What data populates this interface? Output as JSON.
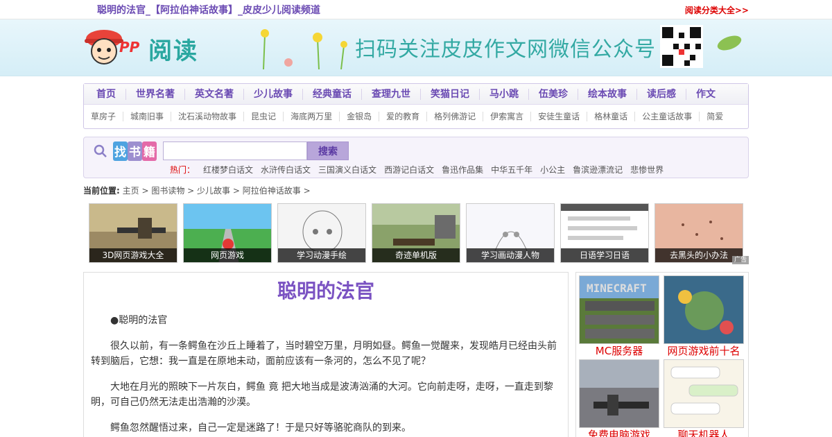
{
  "topbar": {
    "title": "聪明的法官_【阿拉伯神话故事】_皮皮少儿阅读频道",
    "right_link": "阅读分类大全>>"
  },
  "header": {
    "logo_pp": "PP",
    "logo_text": "阅读",
    "slogan": "扫码关注皮皮作文网微信公众号"
  },
  "nav_main": [
    "首页",
    "世界名著",
    "英文名著",
    "少儿故事",
    "经典童话",
    "查理九世",
    "笑猫日记",
    "马小跳",
    "伍美珍",
    "绘本故事",
    "读后感",
    "作文"
  ],
  "nav_sub": [
    "草房子",
    "城南旧事",
    "沈石溪动物故事",
    "昆虫记",
    "海底两万里",
    "金银岛",
    "爱的教育",
    "格列佛游记",
    "伊索寓言",
    "安徒生童话",
    "格林童话",
    "公主童话故事",
    "简爱"
  ],
  "search": {
    "badge": [
      "找",
      "书",
      "籍"
    ],
    "input_value": "",
    "button": "搜索",
    "hot_label": "热门：",
    "hot_items": [
      "红楼梦白话文",
      "水浒传白话文",
      "三国演义白话文",
      "西游记白话文",
      "鲁迅作品集",
      "中华五千年",
      "小公主",
      "鲁滨逊漂流记",
      "悲惨世界"
    ]
  },
  "breadcrumb": {
    "label": "当前位置:",
    "items": [
      "主页",
      "图书读物",
      "少儿故事",
      "阿拉伯神话故事"
    ],
    "sep": " > "
  },
  "thumbs": [
    "3D网页游戏大全",
    "网页游戏",
    "学习动漫手绘",
    "奇迹单机版",
    "学习画动漫人物",
    "日语学习日语",
    "去黑头的小办法"
  ],
  "ad_tag": "广告",
  "article": {
    "title": "聪明的法官",
    "paragraphs": [
      "●聪明的法官",
      "很久以前，有一条鳄鱼在沙丘上睡着了，当时碧空万里，月明如昼。鳄鱼一觉醒来，发现皓月已经由头前转到脑后，它想：我一直是在原地未动，面前应该有一条河的，怎么不见了呢？",
      "大地在月光的照映下一片灰白，鳄鱼 竟 把大地当成是波涛汹涌的大河。它向前走呀，走呀，一直走到黎明，可自己仍然无法走出浩瀚的沙漠。",
      "鳄鱼忽然醒悟过来，自己一定是迷路了！于是只好等骆驼商队的到来。"
    ]
  },
  "sidebar": [
    "MC服务器",
    "网页游戏前十名",
    "免费电脑游戏",
    "聊天机器人"
  ],
  "sidebar_img_text": {
    "minecraft": "MINECRAFT"
  },
  "colors": {
    "accent": "#6b4bb3",
    "red": "#dd0000",
    "teal": "#33a9a3"
  }
}
